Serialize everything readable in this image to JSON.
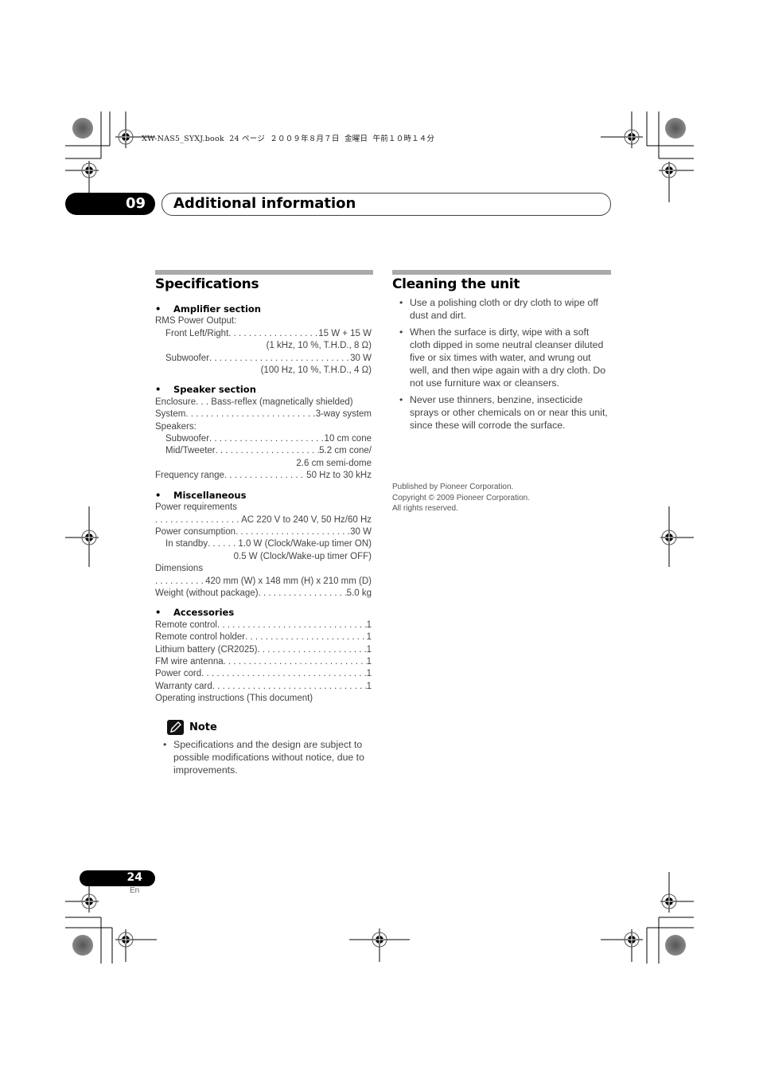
{
  "crop_header": "XW-NAS5_SYXJ.book  24 ページ  ２００９年８月７日  金曜日  午前１０時１４分",
  "chapter": {
    "number": "09",
    "title": "Additional information"
  },
  "specifications": {
    "title": "Specifications",
    "amplifier": {
      "heading": "Amplifier section",
      "rms_label": "RMS Power Output:",
      "front_label": "Front Left/Right",
      "front_value": "15 W + 15 W",
      "front_cond": "(1 kHz, 10 %, T.H.D., 8 Ω)",
      "sub_label": "Subwoofer",
      "sub_value": "30 W",
      "sub_cond": "(100 Hz, 10 %, T.H.D., 4 Ω)"
    },
    "speaker": {
      "heading": "Speaker section",
      "enclosure": "Enclosure. . .  Bass-reflex (magnetically shielded)",
      "system_label": "System",
      "system_value": "3-way system",
      "speakers_label": "Speakers:",
      "subwoofer_label": "Subwoofer",
      "subwoofer_value": "10 cm cone",
      "mid_label": "Mid/Tweeter",
      "mid_value": "5.2 cm cone/",
      "mid_value2": "2.6 cm semi-dome",
      "freq_label": "Frequency range",
      "freq_value": "50 Hz to 30 kHz"
    },
    "misc": {
      "heading": "Miscellaneous",
      "power_req_label": "Power requirements",
      "power_req_value": "AC 220 V to 240 V, 50 Hz/60 Hz",
      "power_cons_label": "Power consumption",
      "power_cons_value": "30 W",
      "standby_label": "In standby",
      "standby_value": "1.0 W (Clock/Wake-up timer ON)",
      "standby_value2": "0.5 W (Clock/Wake-up timer OFF)",
      "dim_label": "Dimensions",
      "dim_value": "420 mm (W) x 148 mm (H) x 210 mm (D)",
      "weight_label": "Weight (without package)",
      "weight_value": "5.0 kg"
    },
    "accessories": {
      "heading": "Accessories",
      "items": [
        {
          "label": "Remote control",
          "qty": "1"
        },
        {
          "label": "Remote control holder",
          "qty": "1"
        },
        {
          "label": "Lithium battery (CR2025)",
          "qty": "1"
        },
        {
          "label": "FM wire antenna",
          "qty": "1"
        },
        {
          "label": "Power cord",
          "qty": "1"
        },
        {
          "label": "Warranty card",
          "qty": "1"
        }
      ],
      "last": "Operating instructions (This document)"
    },
    "note": {
      "label": "Note",
      "text": "Specifications and the design are subject to possible modifications without notice, due to improvements."
    }
  },
  "cleaning": {
    "title": "Cleaning the unit",
    "items": [
      "Use a polishing cloth or dry cloth to wipe off dust and dirt.",
      "When the surface is dirty, wipe with a soft cloth dipped in some neutral cleanser diluted five or six times with water, and wrung out well, and then wipe again with a dry cloth. Do not use furniture wax or cleansers.",
      "Never use thinners, benzine, insecticide sprays or other chemicals on or near this unit, since these will corrode the surface."
    ]
  },
  "publisher": {
    "line1": "Published by Pioneer Corporation.",
    "line2": "Copyright © 2009 Pioneer Corporation.",
    "line3": "All rights reserved."
  },
  "footer": {
    "page": "24",
    "lang": "En"
  }
}
